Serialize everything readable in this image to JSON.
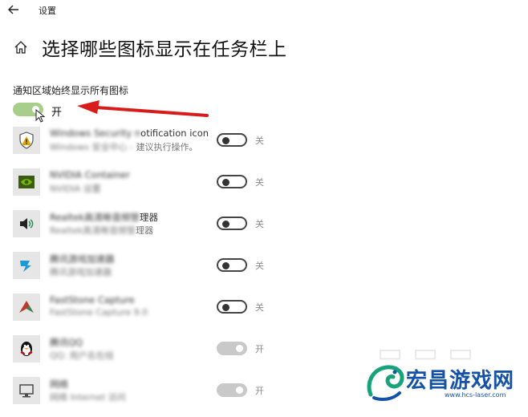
{
  "window": {
    "title": "设置"
  },
  "page": {
    "title": "选择哪些图标显示在任务栏上"
  },
  "master": {
    "label": "通知区域始终显示所有图标",
    "state": "开",
    "on": true
  },
  "rows": [
    {
      "name": "Windows Security notification icon",
      "name_clear": "otification icon",
      "desc": "Windows 安全中心 - 建议执行操作。",
      "desc_clear": "建议执行操作。",
      "state": "关",
      "on": false,
      "icon": "shield-warning-icon",
      "color": "#e0a800"
    },
    {
      "name": "NVIDIA Container",
      "name_clear": "",
      "desc": "NVIDIA 设置",
      "desc_clear": "",
      "state": "关",
      "on": false,
      "icon": "nvidia-icon",
      "color": "#76b900"
    },
    {
      "name": "Realtek高清晰音频管理器",
      "name_clear": "理器",
      "desc": "Realtek高清晰音频管理器",
      "desc_clear": "理器",
      "state": "关",
      "on": false,
      "icon": "speaker-icon",
      "color": "#222222"
    },
    {
      "name": "腾讯游戏加速器",
      "name_clear": "",
      "desc": "腾讯游戏加速器",
      "desc_clear": "",
      "state": "关",
      "on": false,
      "icon": "accelerator-icon",
      "color": "#1a9ad6"
    },
    {
      "name": "FastStone Capture",
      "name_clear": "",
      "desc": "FastStone Capture 9.0",
      "desc_clear": "",
      "state": "关",
      "on": false,
      "icon": "capture-icon",
      "color": "#c0392b"
    },
    {
      "name": "腾讯QQ",
      "name_clear": "",
      "desc": "QQ: 用户名在线",
      "desc_clear": "",
      "state": "开",
      "on": true,
      "icon": "qq-penguin-icon",
      "color": "#111111"
    },
    {
      "name": "网络",
      "name_clear": "",
      "desc": "网络 Internet 访问",
      "desc_clear": "",
      "state": "开",
      "on": true,
      "icon": "network-icon",
      "color": "#4a4a4a"
    }
  ],
  "watermark": {
    "brand": "宏昌游戏网",
    "url": "www.hcs-laser.com"
  }
}
